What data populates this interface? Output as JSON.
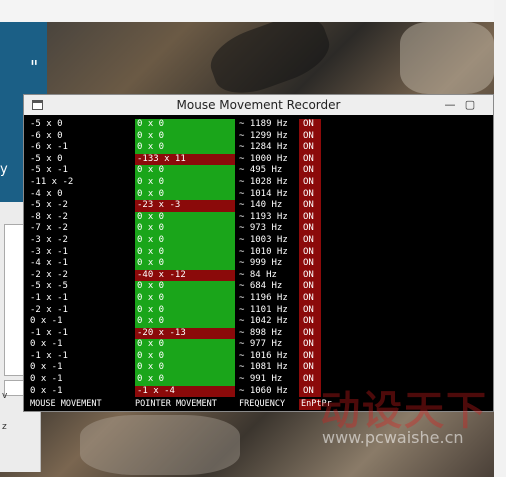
{
  "window": {
    "title": "Mouse Movement Recorder"
  },
  "controls": {
    "minimize": "—",
    "maximize": "▢"
  },
  "desktop": {
    "left_text": "y",
    "quote": "\"",
    "side_z": "z",
    "side_v": "v"
  },
  "headers": {
    "mouse": "MOUSE MOVEMENT",
    "pointer": "POINTER MOVEMENT",
    "freq": "FREQUENCY",
    "flags": "EnPtPr"
  },
  "watermark": {
    "main": "动设天下",
    "url": "www.pcwaishe.cn"
  },
  "rows": [
    {
      "mouse": "-5 x 0",
      "pointer": "0 x 0",
      "freq": "~ 1189 Hz",
      "on": "ON",
      "hit": false
    },
    {
      "mouse": "-6 x 0",
      "pointer": "0 x 0",
      "freq": "~ 1299 Hz",
      "on": "ON",
      "hit": false
    },
    {
      "mouse": "-6 x -1",
      "pointer": "0 x 0",
      "freq": "~ 1284 Hz",
      "on": "ON",
      "hit": false
    },
    {
      "mouse": "-5 x 0",
      "pointer": "-133 x 11",
      "freq": "~ 1000 Hz",
      "on": "ON",
      "hit": true
    },
    {
      "mouse": "-5 x -1",
      "pointer": "0 x 0",
      "freq": "~ 495 Hz",
      "on": "ON",
      "hit": false
    },
    {
      "mouse": "-11 x -2",
      "pointer": "0 x 0",
      "freq": "~ 1028 Hz",
      "on": "ON",
      "hit": false
    },
    {
      "mouse": "-4 x 0",
      "pointer": "0 x 0",
      "freq": "~ 1014 Hz",
      "on": "ON",
      "hit": false
    },
    {
      "mouse": "-5 x -2",
      "pointer": "-23 x -3",
      "freq": "~ 140 Hz",
      "on": "ON",
      "hit": true
    },
    {
      "mouse": "-8 x -2",
      "pointer": "0 x 0",
      "freq": "~ 1193 Hz",
      "on": "ON",
      "hit": false
    },
    {
      "mouse": "-7 x -2",
      "pointer": "0 x 0",
      "freq": "~ 973 Hz",
      "on": "ON",
      "hit": false
    },
    {
      "mouse": "-3 x -2",
      "pointer": "0 x 0",
      "freq": "~ 1003 Hz",
      "on": "ON",
      "hit": false
    },
    {
      "mouse": "-3 x -1",
      "pointer": "0 x 0",
      "freq": "~ 1010 Hz",
      "on": "ON",
      "hit": false
    },
    {
      "mouse": "-4 x -1",
      "pointer": "0 x 0",
      "freq": "~ 999 Hz",
      "on": "ON",
      "hit": false
    },
    {
      "mouse": "-2 x -2",
      "pointer": "-40 x -12",
      "freq": "~ 84 Hz",
      "on": "ON",
      "hit": true
    },
    {
      "mouse": "-5 x -5",
      "pointer": "0 x 0",
      "freq": "~ 684 Hz",
      "on": "ON",
      "hit": false
    },
    {
      "mouse": "-1 x -1",
      "pointer": "0 x 0",
      "freq": "~ 1196 Hz",
      "on": "ON",
      "hit": false
    },
    {
      "mouse": "-2 x -1",
      "pointer": "0 x 0",
      "freq": "~ 1101 Hz",
      "on": "ON",
      "hit": false
    },
    {
      "mouse": "0 x -1",
      "pointer": "0 x 0",
      "freq": "~ 1042 Hz",
      "on": "ON",
      "hit": false
    },
    {
      "mouse": "-1 x -1",
      "pointer": "-20 x -13",
      "freq": "~ 898 Hz",
      "on": "ON",
      "hit": true
    },
    {
      "mouse": "0 x -1",
      "pointer": "0 x 0",
      "freq": "~ 977 Hz",
      "on": "ON",
      "hit": false
    },
    {
      "mouse": "-1 x -1",
      "pointer": "0 x 0",
      "freq": "~ 1016 Hz",
      "on": "ON",
      "hit": false
    },
    {
      "mouse": "0 x -1",
      "pointer": "0 x 0",
      "freq": "~ 1081 Hz",
      "on": "ON",
      "hit": false
    },
    {
      "mouse": "0 x -1",
      "pointer": "0 x 0",
      "freq": "~ 991 Hz",
      "on": "ON",
      "hit": false
    },
    {
      "mouse": "0 x -1",
      "pointer": "-1 x -4",
      "freq": "~ 1060 Hz",
      "on": "ON",
      "hit": true
    }
  ]
}
